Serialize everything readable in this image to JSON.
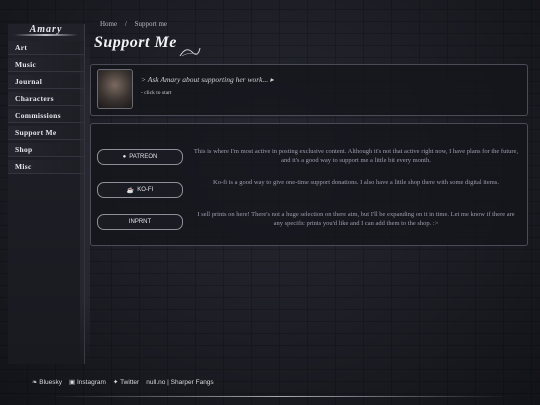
{
  "sidebar": {
    "brand": "Amary",
    "items": [
      {
        "label": "Art"
      },
      {
        "label": "Music"
      },
      {
        "label": "Journal"
      },
      {
        "label": "Characters"
      },
      {
        "label": "Commissions"
      },
      {
        "label": "Support Me"
      },
      {
        "label": "Shop"
      },
      {
        "label": "Misc"
      }
    ]
  },
  "breadcrumb": {
    "home": "Home",
    "separator": "/",
    "current": "Support me"
  },
  "page_title": "Support Me",
  "dialog": {
    "prompt": "> Ask Amary about supporting her work...  ▸",
    "hint": "- click to start"
  },
  "support": [
    {
      "badge": "PATREON",
      "icon": "patreon-icon",
      "text": "This is where I'm most active in posting exclusive content. Although it's not that active right now, I have plans for the future, and it's a good way to support me a little bit every month."
    },
    {
      "badge": "KO-FI",
      "icon": "kofi-icon",
      "text": "Ko-fi is a good way to give one-time support donations. I also have a little shop there with some digital items."
    },
    {
      "badge": "INPRNT",
      "icon": "",
      "text": "I sell prints on here! There's not a huge selection on there atm, but I'll be expanding on it in time. Let me know if there are any specific prints you'd like and I can add them to the shop. :>"
    }
  ],
  "footer": {
    "links": [
      {
        "label": "Bluesky",
        "icon": "butterfly-icon"
      },
      {
        "label": "Instagram",
        "icon": "instagram-icon"
      },
      {
        "label": "Twitter",
        "icon": "twitter-icon"
      }
    ],
    "credit": "null.no | Sharper Fangs"
  }
}
